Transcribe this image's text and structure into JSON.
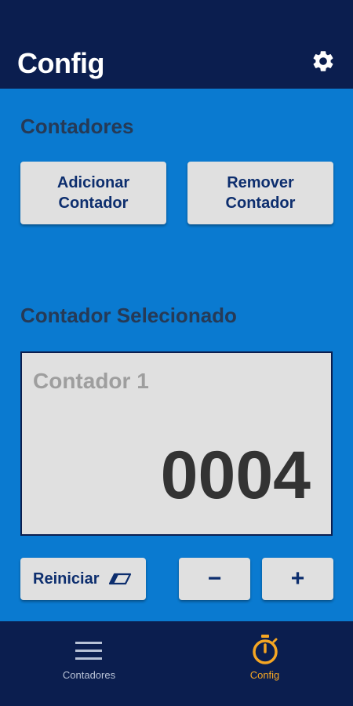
{
  "header": {
    "title": "Config",
    "settings_icon": "gear-icon"
  },
  "sections": {
    "counters_title": "Contadores",
    "selected_title": "Contador Selecionado"
  },
  "buttons": {
    "add_counter": "Adicionar Contador",
    "remove_counter": "Remover Contador",
    "reset": "Reiniciar",
    "decrement": "−",
    "increment": "+"
  },
  "counter": {
    "name": "Contador 1",
    "value": "0004"
  },
  "bottom_nav": {
    "items": [
      {
        "label": "Contadores",
        "icon": "menu-icon",
        "active": false
      },
      {
        "label": "Config",
        "icon": "stopwatch-icon",
        "active": true
      }
    ]
  },
  "colors": {
    "header_bg": "#0b1e4f",
    "main_bg": "#0a7ad0",
    "button_bg": "#e0e0e0",
    "button_text": "#0d2e6e",
    "active_nav": "#f5a623",
    "inactive_nav": "#b8c2d6"
  }
}
